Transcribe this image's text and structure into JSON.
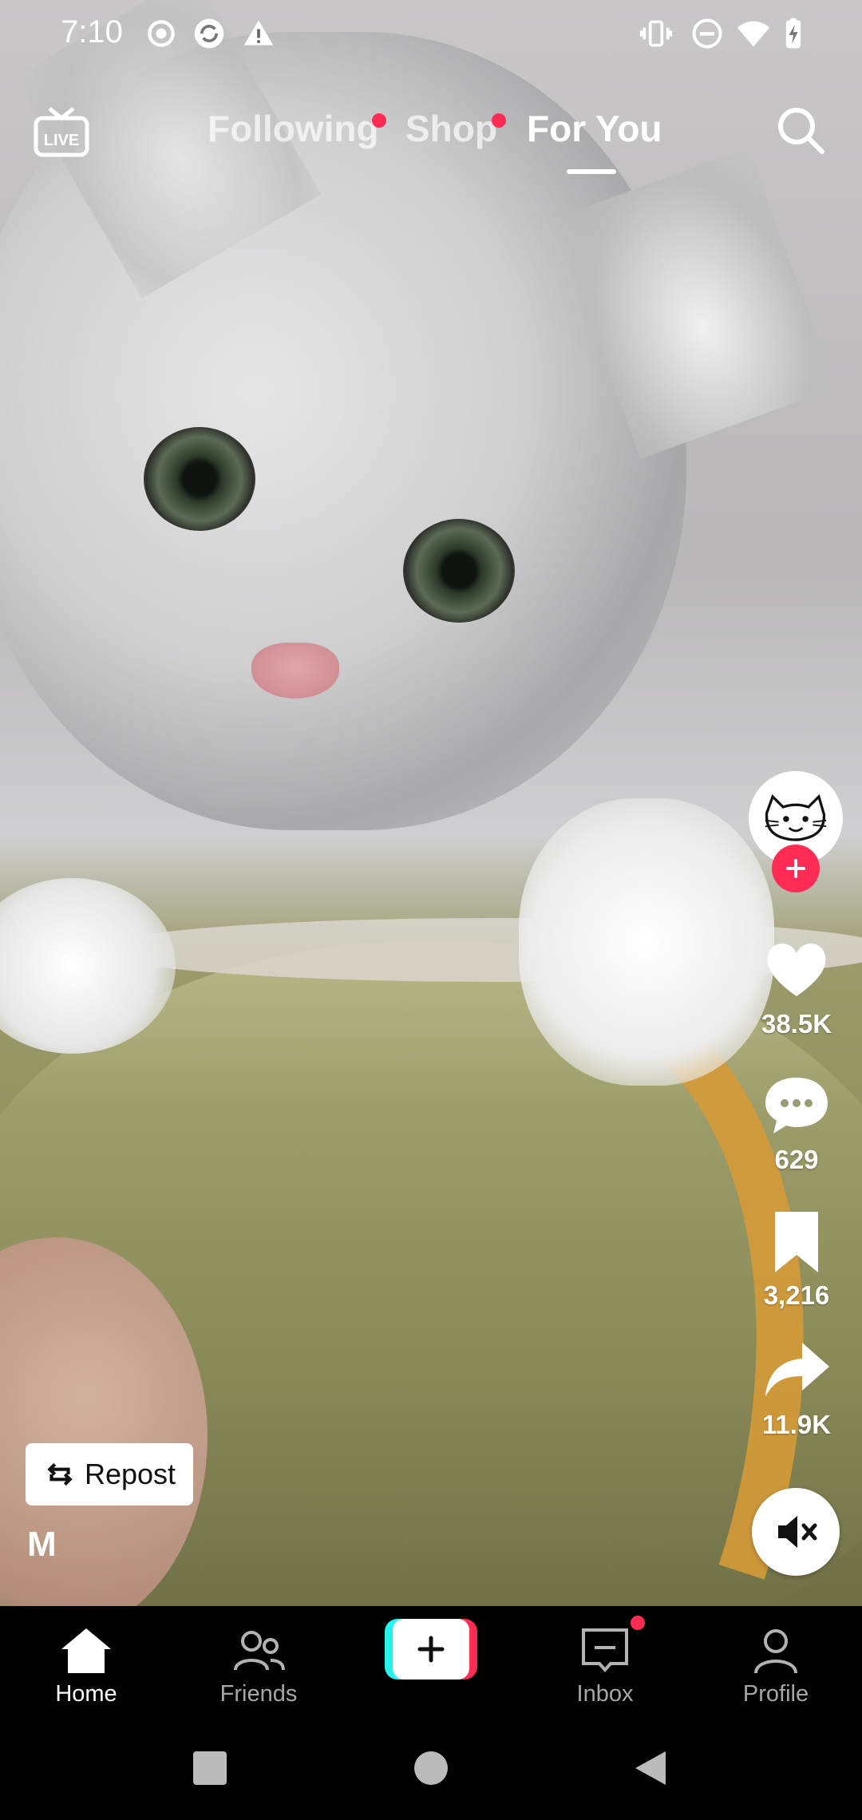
{
  "status_bar": {
    "time": "7:10",
    "left_icons": [
      "record-icon",
      "sync-icon",
      "warning-icon"
    ],
    "right_icons": [
      "vibrate-icon",
      "dnd-icon",
      "wifi-icon",
      "battery-icon"
    ]
  },
  "top_nav": {
    "live_icon": "live-icon",
    "tabs": [
      {
        "label": "Following",
        "badge": true
      },
      {
        "label": "Shop",
        "badge": true
      },
      {
        "label": "For You",
        "active": true
      }
    ],
    "search_icon": "search-icon"
  },
  "actions": {
    "likes": "38.5K",
    "comments": "629",
    "saves": "3,216",
    "shares": "11.9K"
  },
  "repost": {
    "label": "Repost"
  },
  "author_initial": "M",
  "bottom_nav": {
    "items": [
      {
        "label": "Home",
        "icon": "home-icon",
        "active": true
      },
      {
        "label": "Friends",
        "icon": "friends-icon"
      },
      {
        "label": "",
        "icon": "create-icon"
      },
      {
        "label": "Inbox",
        "icon": "inbox-icon",
        "badge": true
      },
      {
        "label": "Profile",
        "icon": "profile-icon"
      }
    ]
  },
  "colors": {
    "accent": "#fe2c55",
    "cyan": "#25f4ee"
  }
}
